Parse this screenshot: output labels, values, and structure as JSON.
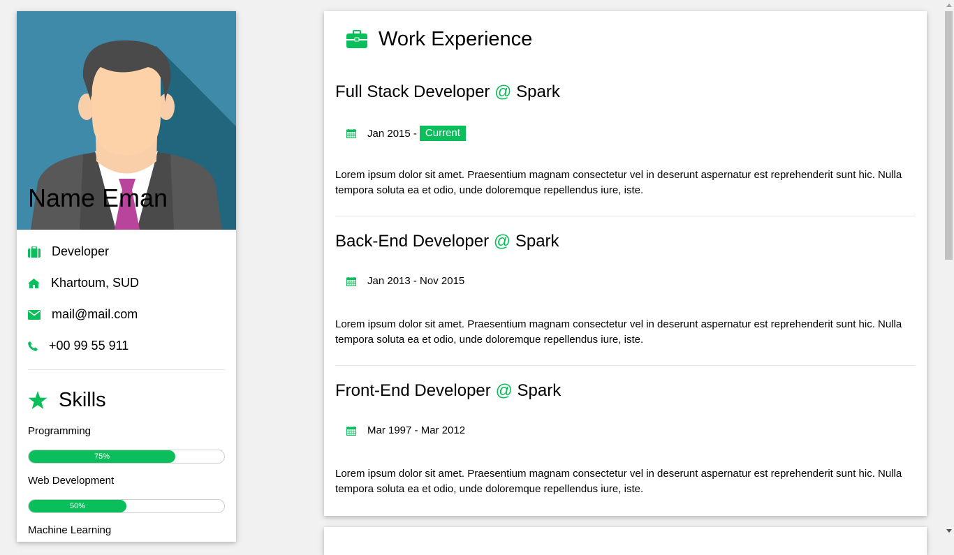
{
  "profile": {
    "name": "Name Eman",
    "role": "Developer",
    "location": "Khartoum, SUD",
    "email": "mail@mail.com",
    "phone": "+00 99 55 911"
  },
  "skills": {
    "title": "Skills",
    "items": [
      {
        "label": "Programming",
        "percent_text": "75%",
        "percent": 75
      },
      {
        "label": "Web Development",
        "percent_text": "50%",
        "percent": 50
      },
      {
        "label": "Machine Learning"
      }
    ]
  },
  "work": {
    "title": "Work Experience",
    "jobs": [
      {
        "role": "Full Stack Developer",
        "at": "@",
        "company": "Spark",
        "date": "Jan 2015 -",
        "badge": "Current",
        "description": "Lorem ipsum dolor sit amet. Praesentium magnam consectetur vel in deserunt aspernatur est reprehenderit sunt hic. Nulla tempora soluta ea et odio, unde doloremque repellendus iure, iste."
      },
      {
        "role": "Back-End Developer",
        "at": "@",
        "company": "Spark",
        "date": "Jan 2013 - Nov 2015",
        "description": "Lorem ipsum dolor sit amet. Praesentium magnam consectetur vel in deserunt aspernatur est reprehenderit sunt hic. Nulla tempora soluta ea et odio, unde doloremque repellendus iure, iste."
      },
      {
        "role": "Front-End Developer",
        "at": "@",
        "company": "Spark",
        "date": "Mar 1997 - Mar 2012",
        "description": "Lorem ipsum dolor sit amet. Praesentium magnam consectetur vel in deserunt aspernatur est reprehenderit sunt hic. Nulla tempora soluta ea et odio, unde doloremque repellendus iure, iste."
      }
    ]
  },
  "icons": {
    "role": "briefcase-icon",
    "location": "home-icon",
    "email": "envelope-icon",
    "phone": "phone-icon",
    "skills": "star-icon",
    "work": "briefcase-icon",
    "date": "calendar-icon"
  },
  "colors": {
    "accent": "#0abf5b",
    "avatar_bg": "#3f8aa8",
    "page_bg": "#f1f1f1"
  }
}
